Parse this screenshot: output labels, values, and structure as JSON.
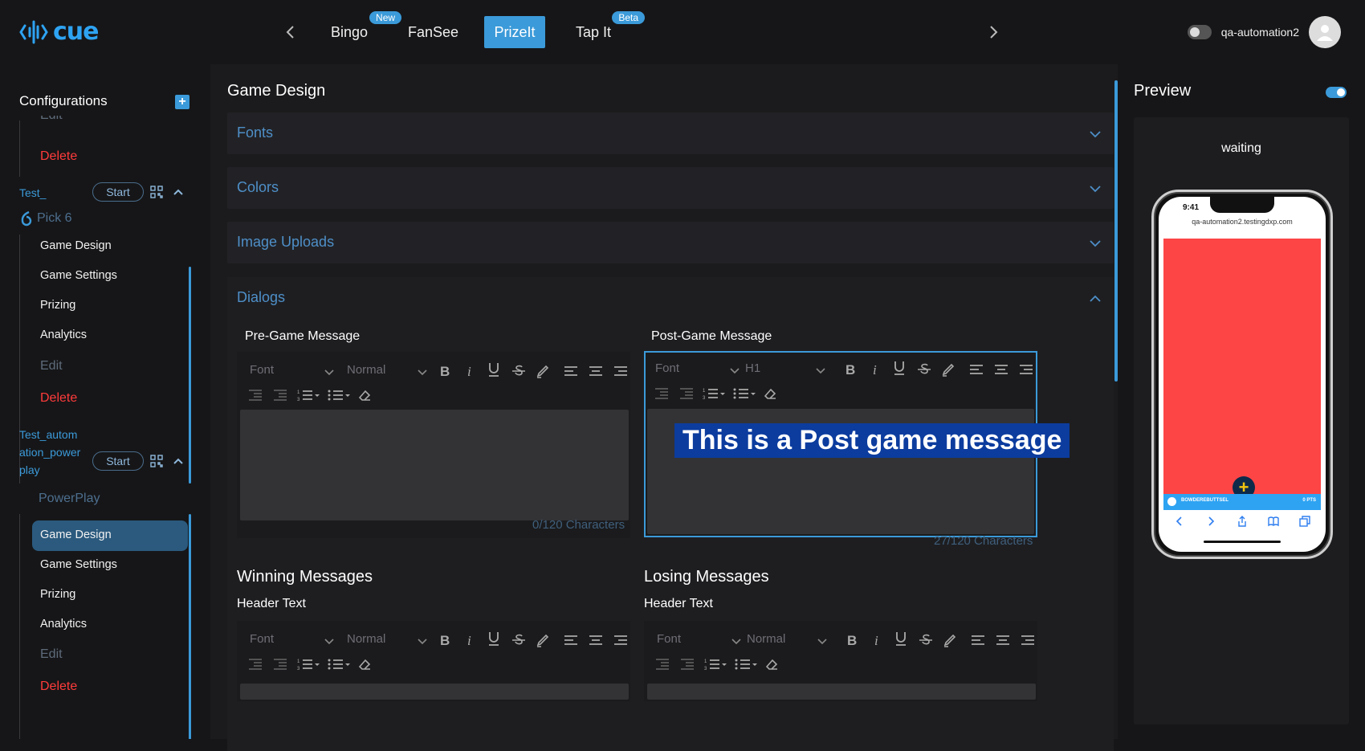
{
  "app": {
    "logo_text": "cue",
    "brand_color": "#2ea3f2",
    "accent_color": "#3b9ad9"
  },
  "topnav": {
    "tabs": [
      {
        "label": "Bingo",
        "badge": "New",
        "active": false
      },
      {
        "label": "FanSee",
        "badge": null,
        "active": false
      },
      {
        "label": "PrizeIt",
        "badge": null,
        "active": true
      },
      {
        "label": "Tap It",
        "badge": "Beta",
        "active": false
      }
    ]
  },
  "account": {
    "username": "qa-automation2"
  },
  "sidebar": {
    "title": "Configurations",
    "partial_top_item": "Edit",
    "top_delete": "Delete",
    "configs": [
      {
        "name": "Test_",
        "start_label": "Start",
        "category": "Pick 6",
        "items": [
          "Game Design",
          "Game Settings",
          "Prizing",
          "Analytics"
        ],
        "edit": "Edit",
        "delete": "Delete"
      },
      {
        "name_lines": [
          "Test_autom",
          "ation_power",
          "play"
        ],
        "start_label": "Start",
        "category": "PowerPlay",
        "items": [
          "Game Design",
          "Game Settings",
          "Prizing",
          "Analytics"
        ],
        "selected": "Game Design",
        "edit": "Edit",
        "delete": "Delete"
      }
    ]
  },
  "main": {
    "title": "Game Design",
    "sections": [
      "Fonts",
      "Colors",
      "Image Uploads",
      "Dialogs"
    ],
    "dialogs": {
      "pre_game": {
        "label": "Pre-Game Message",
        "font": "Font",
        "size": "Normal",
        "content": "",
        "counter": "0/120 Characters"
      },
      "post_game": {
        "label": "Post-Game Message",
        "font": "Font",
        "size": "H1",
        "content": "This is a Post game message",
        "counter": "27/120 Characters"
      },
      "winning": {
        "title": "Winning Messages",
        "header_label": "Header Text",
        "font": "Font",
        "size": "Normal"
      },
      "losing": {
        "title": "Losing Messages",
        "header_label": "Header Text",
        "font": "Font",
        "size": "Normal"
      }
    }
  },
  "preview": {
    "title": "Preview",
    "status": "waiting",
    "phone": {
      "time": "9:41",
      "url": "qa-automation2.testingdxp.com",
      "bar_left": "BOWDEREBUTTSEL",
      "bar_right": "0 PTS",
      "background_color": "#fd4546"
    }
  }
}
